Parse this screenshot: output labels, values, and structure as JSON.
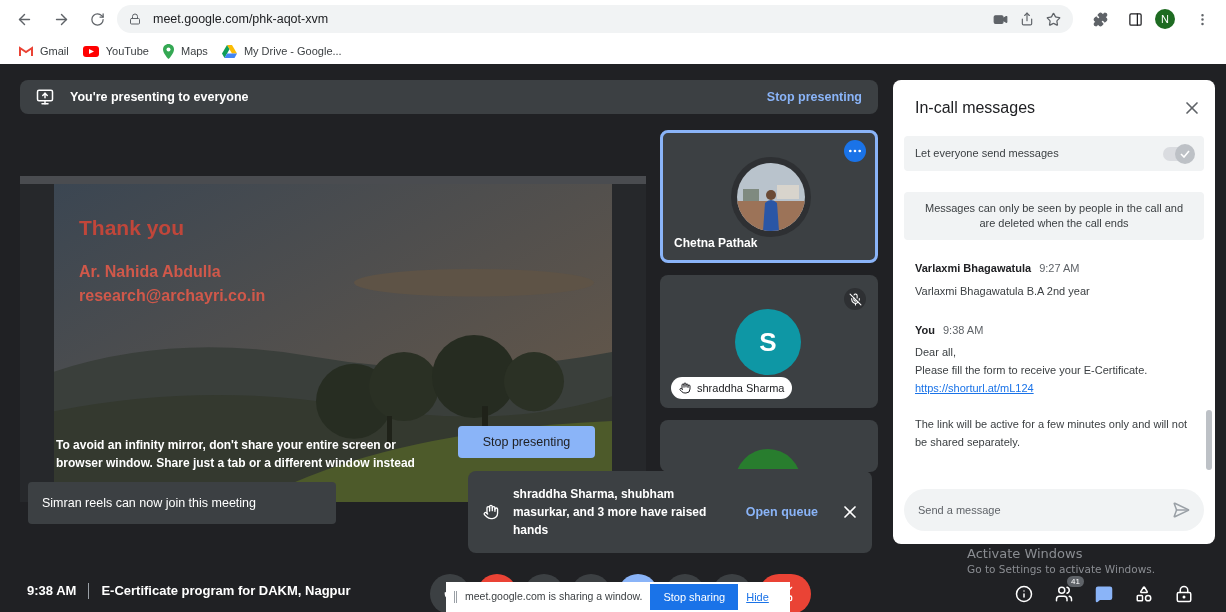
{
  "browser": {
    "url": "meet.google.com/phk-aqot-xvm",
    "profile_initial": "N",
    "bookmarks": [
      {
        "label": "Gmail",
        "kind": "gmail"
      },
      {
        "label": "YouTube",
        "kind": "youtube"
      },
      {
        "label": "Maps",
        "kind": "maps"
      },
      {
        "label": "My Drive - Google...",
        "kind": "drive"
      }
    ]
  },
  "banner": {
    "text": "You're presenting to everyone",
    "action": "Stop presenting"
  },
  "slide": {
    "title": "Thank you",
    "name": "Ar. Nahida Abdulla",
    "email": "research@archayri.co.in"
  },
  "mirror_warning": {
    "text": "To avoid an infinity mirror, don't share your entire screen or browser window. Share just a tab or a different window instead",
    "button": "Stop presenting"
  },
  "participants": [
    {
      "name": "Chetna Pathak",
      "selected": true
    },
    {
      "kind": "initial",
      "name": "shraddha Sharma",
      "initial": "S",
      "color": "#0e97a5",
      "selected": false,
      "muted": true,
      "hand_raised": true
    },
    {
      "kind": "initial",
      "color": "#287d2e",
      "selected": false
    }
  ],
  "join_toast": "Simran reels can now join this meeting",
  "hands_toast": {
    "text": "shraddha Sharma, shubham masurkar, and 3 more have raised hands",
    "action": "Open queue"
  },
  "footer": {
    "time": "9:38 AM",
    "meeting_title": "E-Certificate program for DAKM, Nagpur",
    "people_count": "41"
  },
  "sharing_bar": {
    "text": "meet.google.com is sharing a window.",
    "stop": "Stop sharing",
    "hide": "Hide"
  },
  "chat": {
    "title": "In-call messages",
    "toggle": {
      "label": "Let everyone send messages",
      "on": true
    },
    "notice": "Messages can only be seen by people in the call and are deleted when the call ends",
    "messages": [
      {
        "sender": "Varlaxmi Bhagawatula",
        "time": "9:27 AM",
        "lines": [
          {
            "kind": "text",
            "text": "Varlaxmi Bhagawatula  B.A 2nd year"
          }
        ]
      },
      {
        "sender": "You",
        "time": "9:38 AM",
        "lines": [
          {
            "kind": "text",
            "text": "Dear all,"
          },
          {
            "kind": "text",
            "text": "Please fill the form to receive your E-Certificate."
          },
          {
            "kind": "link",
            "text": "https://shorturl.at/mL124"
          },
          {
            "kind": "gap"
          },
          {
            "kind": "text",
            "text": "The link will be active for a few minutes only and will not be shared separately."
          }
        ]
      }
    ],
    "placeholder": "Send a message"
  },
  "os_notice": {
    "title": "Activate Windows",
    "text": "Go to Settings to activate Windows."
  }
}
